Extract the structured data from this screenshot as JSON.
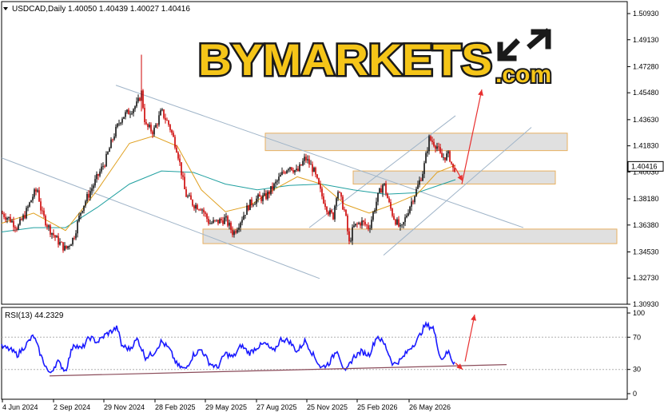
{
  "header": {
    "symbol_line": "USDCAD,Daily  1.40050 1.40439 1.40027 1.40416",
    "rsi_line": "RSI(13) 44.2329"
  },
  "logo": {
    "wordmark": "BYMARKETS",
    "suffix": ".com"
  },
  "colors": {
    "candle_up": "#111111",
    "candle_down": "#cc0000",
    "ma_fast": "#e0a020",
    "ma_slow": "#20a0a0",
    "channel": "#9fb4c8",
    "zone_fill": "#e0e0e0",
    "zone_border": "#e8b060",
    "arrow": "#e83030",
    "rsi_line": "#1a1aff",
    "rsi_trend": "#8b4c5a",
    "logo_yellow": "#f5c518",
    "logo_dark": "#1a1a1a"
  },
  "chart_data": [
    {
      "type": "line",
      "title": "USDCAD,Daily",
      "subtitle": "1.40050 1.40439 1.40027 1.40416",
      "style": "candlestick",
      "y_ticks": [
        "1.50930",
        "1.49130",
        "1.47280",
        "1.45480",
        "1.43630",
        "1.41830",
        "1.40030",
        "1.38180",
        "1.36380",
        "1.34530",
        "1.32730",
        "1.30930"
      ],
      "ylim": [
        1.3093,
        1.5093
      ],
      "last_price": "1.40416",
      "x_ticks": [
        "4 Jun 2024",
        "2 Sep 2024",
        "29 Nov 2024",
        "28 Feb 2025",
        "29 May 2025",
        "27 Aug 2025",
        "25 Nov 2025",
        "25 Feb 2026",
        "26 May 2026"
      ],
      "close_path": [
        {
          "x": 0,
          "y": 1.372
        },
        {
          "x": 10,
          "y": 1.368
        },
        {
          "x": 20,
          "y": 1.362
        },
        {
          "x": 30,
          "y": 1.372
        },
        {
          "x": 40,
          "y": 1.385
        },
        {
          "x": 45,
          "y": 1.388
        },
        {
          "x": 50,
          "y": 1.372
        },
        {
          "x": 60,
          "y": 1.361
        },
        {
          "x": 70,
          "y": 1.353
        },
        {
          "x": 80,
          "y": 1.347
        },
        {
          "x": 90,
          "y": 1.355
        },
        {
          "x": 100,
          "y": 1.375
        },
        {
          "x": 110,
          "y": 1.386
        },
        {
          "x": 120,
          "y": 1.397
        },
        {
          "x": 130,
          "y": 1.408
        },
        {
          "x": 140,
          "y": 1.425
        },
        {
          "x": 150,
          "y": 1.438
        },
        {
          "x": 160,
          "y": 1.442
        },
        {
          "x": 170,
          "y": 1.447
        },
        {
          "x": 175,
          "y": 1.455
        },
        {
          "x": 180,
          "y": 1.432
        },
        {
          "x": 190,
          "y": 1.428
        },
        {
          "x": 200,
          "y": 1.442
        },
        {
          "x": 210,
          "y": 1.432
        },
        {
          "x": 220,
          "y": 1.415
        },
        {
          "x": 230,
          "y": 1.385
        },
        {
          "x": 240,
          "y": 1.378
        },
        {
          "x": 250,
          "y": 1.376
        },
        {
          "x": 260,
          "y": 1.365
        },
        {
          "x": 270,
          "y": 1.366
        },
        {
          "x": 280,
          "y": 1.368
        },
        {
          "x": 290,
          "y": 1.358
        },
        {
          "x": 300,
          "y": 1.368
        },
        {
          "x": 310,
          "y": 1.378
        },
        {
          "x": 320,
          "y": 1.382
        },
        {
          "x": 330,
          "y": 1.383
        },
        {
          "x": 340,
          "y": 1.39
        },
        {
          "x": 350,
          "y": 1.398
        },
        {
          "x": 360,
          "y": 1.405
        },
        {
          "x": 370,
          "y": 1.4
        },
        {
          "x": 380,
          "y": 1.41
        },
        {
          "x": 390,
          "y": 1.402
        },
        {
          "x": 400,
          "y": 1.385
        },
        {
          "x": 410,
          "y": 1.372
        },
        {
          "x": 415,
          "y": 1.37
        },
        {
          "x": 420,
          "y": 1.389
        },
        {
          "x": 430,
          "y": 1.372
        },
        {
          "x": 435,
          "y": 1.351
        },
        {
          "x": 440,
          "y": 1.362
        },
        {
          "x": 450,
          "y": 1.366
        },
        {
          "x": 460,
          "y": 1.362
        },
        {
          "x": 470,
          "y": 1.382
        },
        {
          "x": 478,
          "y": 1.393
        },
        {
          "x": 485,
          "y": 1.378
        },
        {
          "x": 490,
          "y": 1.37
        },
        {
          "x": 500,
          "y": 1.36
        },
        {
          "x": 510,
          "y": 1.376
        },
        {
          "x": 520,
          "y": 1.389
        },
        {
          "x": 528,
          "y": 1.402
        },
        {
          "x": 535,
          "y": 1.423
        },
        {
          "x": 540,
          "y": 1.421
        },
        {
          "x": 545,
          "y": 1.418
        },
        {
          "x": 550,
          "y": 1.41
        },
        {
          "x": 560,
          "y": 1.412
        },
        {
          "x": 565,
          "y": 1.402
        },
        {
          "x": 568,
          "y": 1.404
        }
      ],
      "ma_fast": [
        {
          "x": 0,
          "y": 1.365
        },
        {
          "x": 40,
          "y": 1.372
        },
        {
          "x": 80,
          "y": 1.36
        },
        {
          "x": 120,
          "y": 1.388
        },
        {
          "x": 160,
          "y": 1.42
        },
        {
          "x": 190,
          "y": 1.425
        },
        {
          "x": 220,
          "y": 1.418
        },
        {
          "x": 250,
          "y": 1.388
        },
        {
          "x": 280,
          "y": 1.373
        },
        {
          "x": 310,
          "y": 1.377
        },
        {
          "x": 340,
          "y": 1.388
        },
        {
          "x": 370,
          "y": 1.397
        },
        {
          "x": 400,
          "y": 1.392
        },
        {
          "x": 430,
          "y": 1.378
        },
        {
          "x": 460,
          "y": 1.372
        },
        {
          "x": 490,
          "y": 1.378
        },
        {
          "x": 520,
          "y": 1.385
        },
        {
          "x": 545,
          "y": 1.4
        },
        {
          "x": 568,
          "y": 1.405
        }
      ],
      "ma_slow": [
        {
          "x": 0,
          "y": 1.359
        },
        {
          "x": 40,
          "y": 1.362
        },
        {
          "x": 80,
          "y": 1.362
        },
        {
          "x": 120,
          "y": 1.376
        },
        {
          "x": 160,
          "y": 1.392
        },
        {
          "x": 200,
          "y": 1.401
        },
        {
          "x": 240,
          "y": 1.4
        },
        {
          "x": 280,
          "y": 1.392
        },
        {
          "x": 320,
          "y": 1.388
        },
        {
          "x": 360,
          "y": 1.391
        },
        {
          "x": 400,
          "y": 1.392
        },
        {
          "x": 440,
          "y": 1.388
        },
        {
          "x": 480,
          "y": 1.385
        },
        {
          "x": 520,
          "y": 1.386
        },
        {
          "x": 568,
          "y": 1.395
        }
      ],
      "zones": [
        {
          "x0": 330,
          "x1": 708,
          "y0": 1.415,
          "y1": 1.427
        },
        {
          "x0": 440,
          "x1": 693,
          "y0": 1.392,
          "y1": 1.401
        },
        {
          "x0": 252,
          "x1": 770,
          "y0": 1.351,
          "y1": 1.361
        }
      ],
      "channel_lines": [
        {
          "x0": 0,
          "y0": 1.41,
          "x1": 398,
          "y1": 1.327
        },
        {
          "x0": 143,
          "y0": 1.46,
          "x1": 653,
          "y1": 1.362
        },
        {
          "x0": 385,
          "y0": 1.362,
          "x1": 568,
          "y1": 1.439
        },
        {
          "x0": 478,
          "y0": 1.343,
          "x1": 663,
          "y1": 1.431
        }
      ],
      "arrows": [
        {
          "x0": 576,
          "y0": 1.392,
          "x1": 601,
          "y1": 1.457
        },
        {
          "x0": 568,
          "y0": 1.403,
          "x1": 577,
          "y1": 1.394
        }
      ]
    },
    {
      "type": "line",
      "title": "RSI(13)",
      "subtitle": "44.2329",
      "y_ticks": [
        "100",
        "70",
        "30",
        "0"
      ],
      "ylim": [
        0,
        100
      ],
      "levels": [
        70,
        30
      ],
      "rsi_path": [
        {
          "x": 0,
          "y": 58
        },
        {
          "x": 10,
          "y": 55
        },
        {
          "x": 20,
          "y": 48
        },
        {
          "x": 30,
          "y": 60
        },
        {
          "x": 40,
          "y": 72
        },
        {
          "x": 50,
          "y": 45
        },
        {
          "x": 60,
          "y": 24
        },
        {
          "x": 70,
          "y": 40
        },
        {
          "x": 80,
          "y": 28
        },
        {
          "x": 90,
          "y": 62
        },
        {
          "x": 100,
          "y": 55
        },
        {
          "x": 110,
          "y": 70
        },
        {
          "x": 120,
          "y": 64
        },
        {
          "x": 130,
          "y": 73
        },
        {
          "x": 145,
          "y": 82
        },
        {
          "x": 150,
          "y": 60
        },
        {
          "x": 160,
          "y": 55
        },
        {
          "x": 170,
          "y": 68
        },
        {
          "x": 180,
          "y": 45
        },
        {
          "x": 190,
          "y": 50
        },
        {
          "x": 200,
          "y": 65
        },
        {
          "x": 210,
          "y": 55
        },
        {
          "x": 220,
          "y": 35
        },
        {
          "x": 230,
          "y": 30
        },
        {
          "x": 240,
          "y": 48
        },
        {
          "x": 250,
          "y": 55
        },
        {
          "x": 260,
          "y": 38
        },
        {
          "x": 270,
          "y": 32
        },
        {
          "x": 280,
          "y": 50
        },
        {
          "x": 290,
          "y": 45
        },
        {
          "x": 300,
          "y": 60
        },
        {
          "x": 310,
          "y": 50
        },
        {
          "x": 320,
          "y": 58
        },
        {
          "x": 330,
          "y": 62
        },
        {
          "x": 340,
          "y": 52
        },
        {
          "x": 350,
          "y": 68
        },
        {
          "x": 360,
          "y": 65
        },
        {
          "x": 370,
          "y": 52
        },
        {
          "x": 380,
          "y": 66
        },
        {
          "x": 390,
          "y": 48
        },
        {
          "x": 400,
          "y": 32
        },
        {
          "x": 410,
          "y": 38
        },
        {
          "x": 420,
          "y": 55
        },
        {
          "x": 430,
          "y": 25
        },
        {
          "x": 440,
          "y": 45
        },
        {
          "x": 450,
          "y": 52
        },
        {
          "x": 460,
          "y": 48
        },
        {
          "x": 470,
          "y": 72
        },
        {
          "x": 480,
          "y": 60
        },
        {
          "x": 490,
          "y": 36
        },
        {
          "x": 500,
          "y": 42
        },
        {
          "x": 510,
          "y": 55
        },
        {
          "x": 520,
          "y": 66
        },
        {
          "x": 530,
          "y": 85
        },
        {
          "x": 540,
          "y": 82
        },
        {
          "x": 550,
          "y": 42
        },
        {
          "x": 555,
          "y": 48
        },
        {
          "x": 560,
          "y": 52
        },
        {
          "x": 565,
          "y": 38
        },
        {
          "x": 568,
          "y": 44
        }
      ],
      "trendline": {
        "x0": 60,
        "y0": 22,
        "x1": 632,
        "y1": 36
      },
      "arrows": [
        {
          "x0": 580,
          "y0": 40,
          "x1": 592,
          "y1": 98
        },
        {
          "x0": 568,
          "y0": 38,
          "x1": 577,
          "y1": 30
        }
      ]
    }
  ]
}
